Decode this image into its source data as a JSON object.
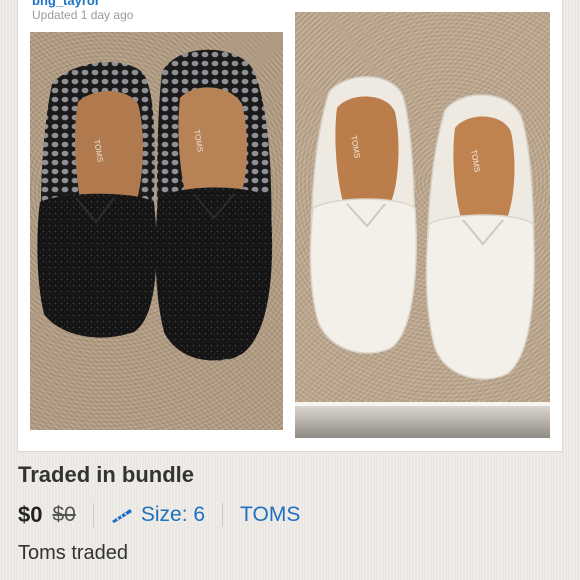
{
  "screenshot": {
    "username_partial": "bng_tayror",
    "updated_text": "Updated 1 day ago",
    "photos": [
      {
        "subject": "black-glitter-shoes",
        "brand_label": "TOMS"
      },
      {
        "subject": "white-canvas-shoes",
        "brand_label": "TOMS"
      }
    ]
  },
  "listing": {
    "title": "Traded in bundle",
    "price": "$0",
    "original_price": "$0",
    "size_label": "Size: 6",
    "brand": "TOMS",
    "description": "Toms traded"
  },
  "colors": {
    "link": "#1f6fc1",
    "title_text": "#333333",
    "background": "#ebe8e3"
  },
  "icons": {
    "size": "ruler-icon"
  }
}
